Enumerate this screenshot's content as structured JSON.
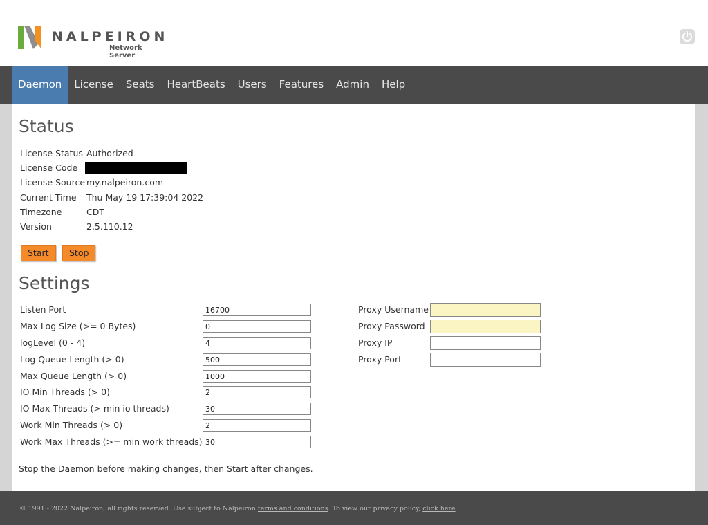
{
  "brand": {
    "name": "NALPEIRON",
    "subtitle": "Network Server",
    "colors": {
      "accent": "#4a7cb0",
      "button": "#f58a2a",
      "nav_bg": "#4a4a4a"
    }
  },
  "nav": {
    "items": [
      "Daemon",
      "License",
      "Seats",
      "HeartBeats",
      "Users",
      "Features",
      "Admin",
      "Help"
    ],
    "active": "Daemon"
  },
  "status": {
    "title": "Status",
    "rows": [
      {
        "label": "License Status",
        "value": "Authorized"
      },
      {
        "label": "License Code",
        "value": ""
      },
      {
        "label": "License Source",
        "value": "my.nalpeiron.com"
      },
      {
        "label": "Current Time",
        "value": "Thu May 19 17:39:04 2022"
      },
      {
        "label": "Timezone",
        "value": "CDT"
      },
      {
        "label": "Version",
        "value": "2.5.110.12"
      }
    ],
    "start_label": "Start",
    "stop_label": "Stop"
  },
  "settings": {
    "title": "Settings",
    "fields": [
      {
        "label": "Listen Port",
        "value": "16700"
      },
      {
        "label": "Max Log Size (>= 0 Bytes)",
        "value": "0"
      },
      {
        "label": "logLevel (0 - 4)",
        "value": "4"
      },
      {
        "label": "Log Queue Length (> 0)",
        "value": "500"
      },
      {
        "label": "Max Queue Length (> 0)",
        "value": "1000"
      },
      {
        "label": "IO Min Threads (> 0)",
        "value": "2"
      },
      {
        "label": "IO Max Threads (> min io threads)",
        "value": "30"
      },
      {
        "label": "Work Min Threads (> 0)",
        "value": "2"
      },
      {
        "label": "Work Max Threads (>= min work threads)",
        "value": "30"
      }
    ],
    "proxy": [
      {
        "label": "Proxy Username",
        "value": ""
      },
      {
        "label": "Proxy Password",
        "value": ""
      },
      {
        "label": "Proxy IP",
        "value": ""
      },
      {
        "label": "Proxy Port",
        "value": ""
      }
    ],
    "note": "Stop the Daemon before making changes, then Start after changes."
  },
  "footer": {
    "prefix": "© 1991 - 2022 Nalpeiron, all rights reserved. Use subject to Nalpeiron ",
    "terms_link": "terms and conditions",
    "middle": ". To view our privacy policy, ",
    "privacy_link": "click here",
    "suffix": "."
  }
}
